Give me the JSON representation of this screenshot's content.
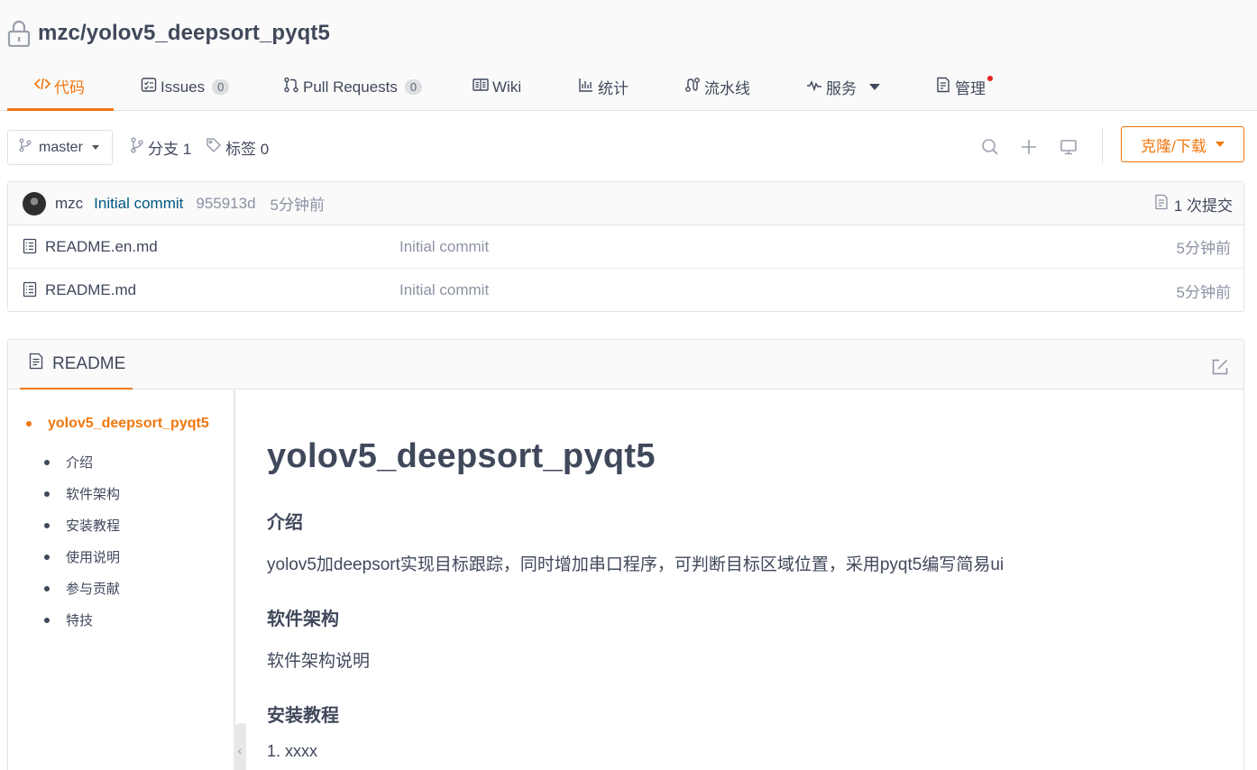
{
  "repo": {
    "title": "mzc/yolov5_deepsort_pyqt5"
  },
  "tabs": [
    {
      "label": "代码",
      "icon": "code-icon"
    },
    {
      "label": "Issues",
      "count": "0",
      "icon": "issues-icon"
    },
    {
      "label": "Pull Requests",
      "count": "0",
      "icon": "pull-request-icon"
    },
    {
      "label": "Wiki",
      "icon": "wiki-icon"
    },
    {
      "label": "统计",
      "icon": "stats-icon"
    },
    {
      "label": "流水线",
      "icon": "pipeline-icon"
    },
    {
      "label": "服务",
      "icon": "service-icon"
    },
    {
      "label": "管理",
      "icon": "manage-icon"
    }
  ],
  "toolbar": {
    "branch": "master",
    "branches_label": "分支 1",
    "tags_label": "标签 0",
    "clone_label": "克隆/下载"
  },
  "commit": {
    "author": "mzc",
    "message": "Initial commit",
    "sha": "955913d",
    "time": "5分钟前",
    "count_label": "1 次提交"
  },
  "files": [
    {
      "name": "README.en.md",
      "message": "Initial commit",
      "time": "5分钟前"
    },
    {
      "name": "README.md",
      "message": "Initial commit",
      "time": "5分钟前"
    }
  ],
  "readme": {
    "tab_label": "README",
    "toc_root": "yolov5_deepsort_pyqt5",
    "toc": [
      "介绍",
      "软件架构",
      "安装教程",
      "使用说明",
      "参与贡献",
      "特技"
    ],
    "title": "yolov5_deepsort_pyqt5",
    "h_intro": "介绍",
    "intro_text": "yolov5加deepsort实现目标跟踪，同时增加串口程序，可判断目标区域位置，采用pyqt5编写简易ui",
    "h_arch": "软件架构",
    "arch_text": "软件架构说明",
    "h_install": "安装教程",
    "install_steps": [
      "xxxx"
    ]
  },
  "colors": {
    "accent": "#f0770d",
    "link": "#005980",
    "text": "#40485b",
    "muted": "#8c92a4"
  }
}
